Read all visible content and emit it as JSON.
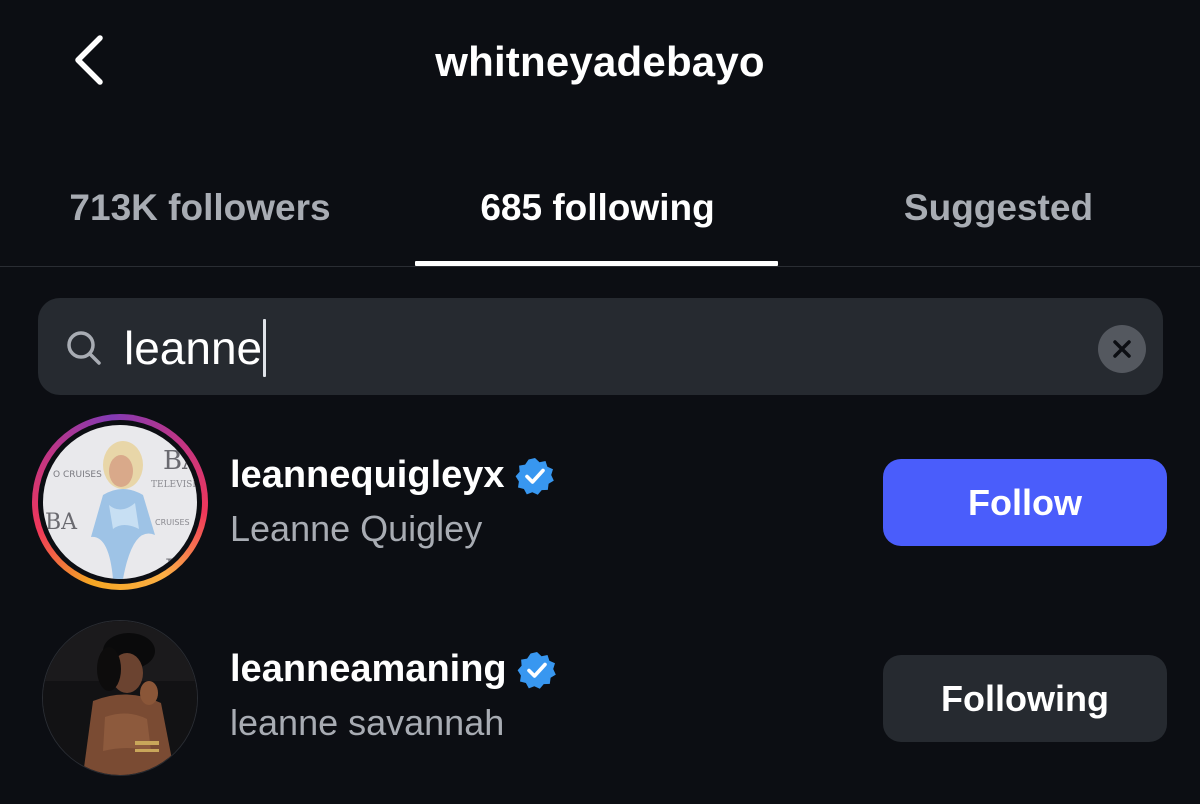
{
  "header": {
    "title": "whitneyadebayo",
    "back_icon": "chevron-left-icon"
  },
  "tabs": [
    {
      "label": "713K followers",
      "active": false
    },
    {
      "label": "685 following",
      "active": true
    },
    {
      "label": "Suggested",
      "active": false
    }
  ],
  "search": {
    "value": "leanne",
    "search_icon": "search-icon",
    "clear_icon": "clear-icon"
  },
  "results": [
    {
      "username": "leannequigleyx",
      "full_name": "Leanne Quigley",
      "verified": true,
      "has_story": true,
      "button_label": "Follow",
      "button_state": "follow"
    },
    {
      "username": "leanneamaning",
      "full_name": "leanne savannah",
      "verified": true,
      "has_story": false,
      "button_label": "Following",
      "button_state": "following"
    }
  ],
  "colors": {
    "background": "#0c0e13",
    "follow_button": "#4a5dfb",
    "following_button": "#262a30",
    "verified_badge": "#3897f0",
    "secondary_text": "#a8acb3"
  }
}
